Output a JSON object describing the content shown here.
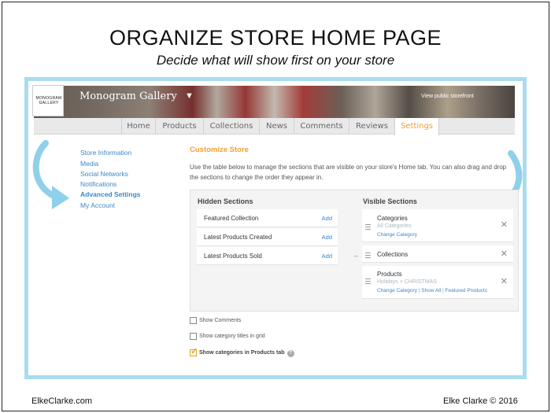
{
  "headline": "ORGANIZE STORE HOME PAGE",
  "subline": "Decide what will show first on your store",
  "banner": {
    "logo_text_line1": "MONOGRAM",
    "logo_text_line2": "GALLERY",
    "store_name": "Monogram Gallery",
    "caret": "▼",
    "view_storefront": "View public storefront"
  },
  "tabs": [
    "Home",
    "Products",
    "Collections",
    "News",
    "Comments",
    "Reviews",
    "Settings"
  ],
  "active_tab": "Settings",
  "sidebar": {
    "items": [
      "Store Information",
      "Media",
      "Social Networks",
      "Notifications",
      "Advanced Settings",
      "My Account"
    ],
    "active": "Advanced Settings"
  },
  "customize": {
    "title": "Customize Store",
    "description": "Use the table below to manage the sections that are visible on your store's Home tab. You can also drag and drop the sections to change the order they appear in."
  },
  "hidden_sections": {
    "header": "Hidden Sections",
    "add_label": "Add",
    "items": [
      "Featured Collection",
      "Latest Products Created",
      "Latest Products Sold"
    ]
  },
  "visible_sections": {
    "header": "Visible Sections",
    "items": [
      {
        "name": "Categories",
        "subtitle": "All Categories",
        "links": [
          "Change Category"
        ]
      },
      {
        "name": "Collections",
        "subtitle": "",
        "links": []
      },
      {
        "name": "Products",
        "subtitle": "Holidays > CHRISTMAS",
        "links": [
          "Change Category",
          "Show All",
          "Featured Products"
        ]
      }
    ]
  },
  "options": [
    {
      "label": "Show Comments",
      "checked": false
    },
    {
      "label": "Show category titles in grid",
      "checked": false
    },
    {
      "label": "Show categories in Products tab",
      "checked": true
    }
  ],
  "footer": {
    "left": "ElkeClarke.com",
    "right": "Elke Clarke © 2016"
  },
  "colors": {
    "accent_orange": "#f0a030",
    "link_blue": "#3d87c8",
    "frame_blue": "#a9dcef"
  }
}
